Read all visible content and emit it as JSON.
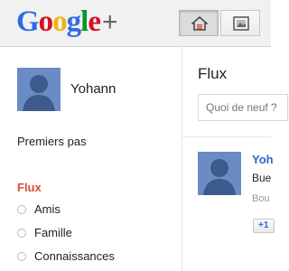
{
  "header": {
    "logo_text": "Google",
    "logo_plus": "+",
    "nav": [
      {
        "icon": "home-icon",
        "active": true
      },
      {
        "icon": "photos-icon",
        "active": false
      }
    ]
  },
  "sidebar": {
    "profile_name": "Yohann",
    "getting_started": "Premiers pas",
    "stream_heading": "Flux",
    "circles": [
      {
        "label": "Amis"
      },
      {
        "label": "Famille"
      },
      {
        "label": "Connaissances"
      }
    ]
  },
  "main": {
    "title": "Flux",
    "share_placeholder": "Quoi de neuf ?",
    "post": {
      "author": "Yoh",
      "text": "Bue",
      "meta": "Bou",
      "plusone_label": "+1"
    }
  }
}
